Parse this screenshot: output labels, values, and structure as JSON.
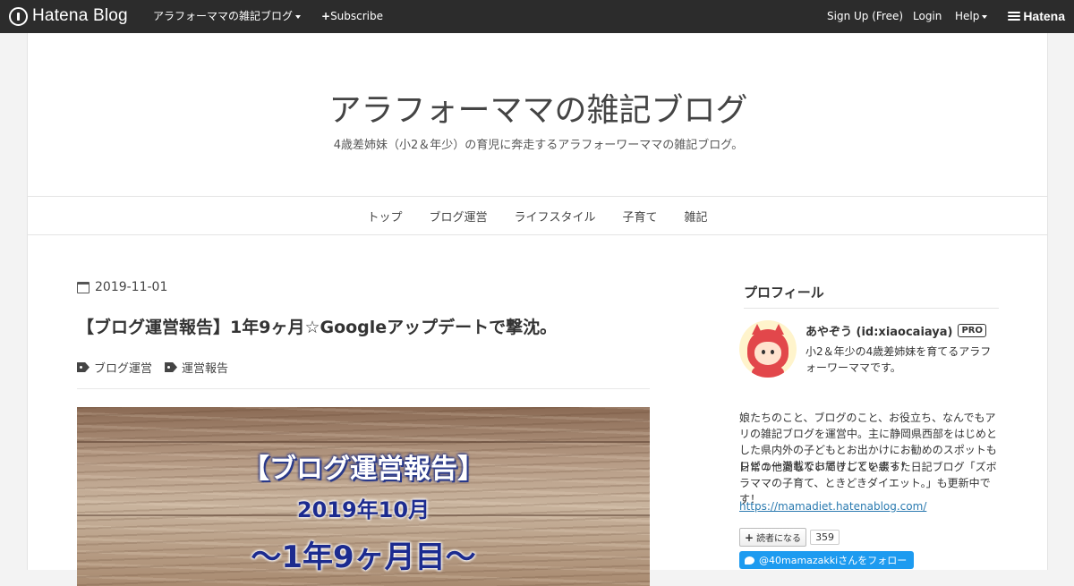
{
  "topbar": {
    "logo_text": "Hatena Blog",
    "blog_menu": "アラフォーママの雑記ブログ",
    "subscribe": "Subscribe",
    "signup": "Sign Up (Free)",
    "login": "Login",
    "help": "Help",
    "brand": "Hatena"
  },
  "header": {
    "title": "アラフォーママの雑記ブログ",
    "description": "4歳差姉妹（小2＆年少）の育児に奔走するアラフォーワーママの雑記ブログ。"
  },
  "nav": [
    "トップ",
    "ブログ運営",
    "ライフスタイル",
    "子育て",
    "雑記"
  ],
  "entry": {
    "date": "2019-11-01",
    "title": "【ブログ運営報告】1年9ヶ月☆Googleアップデートで撃沈。",
    "tags": [
      "ブログ運営",
      "運営報告"
    ],
    "eyecatch": {
      "line1": "【ブログ運営報告】",
      "line2": "2019年10月",
      "line3": "～1年9ヶ月目～"
    }
  },
  "sidebar": {
    "heading": "プロフィール",
    "name": "あやぞう (id:xiaocaiaya)",
    "badge": "PRO",
    "bio1": "小2＆年少の4歳差姉妹を育てるアラフォーワーママです。",
    "bio2": "娘たちのこと、ブログのこと、お役立ち、なんでもアリの雑記ブログを運営中。主に静岡県西部をはじめとした県内外の子どもとお出かけにお勧めのスポットもレビュー満載でお届けしています！",
    "bio3": "日常の他愛もないできごとを綴った日記ブログ「ズボラママの子育て、ときどきダイエット。」も更新中です！",
    "link": "https://mamadiet.hatenablog.com/",
    "reader_button": "読者になる",
    "reader_count": "359",
    "twitter_button": "@40mamazakkiさんをフォロー"
  },
  "colors": {
    "topbar_bg": "#2c2c2c",
    "link": "#2a7ab0",
    "twitter": "#1d9bf0",
    "avatar_red": "#e2474b"
  }
}
